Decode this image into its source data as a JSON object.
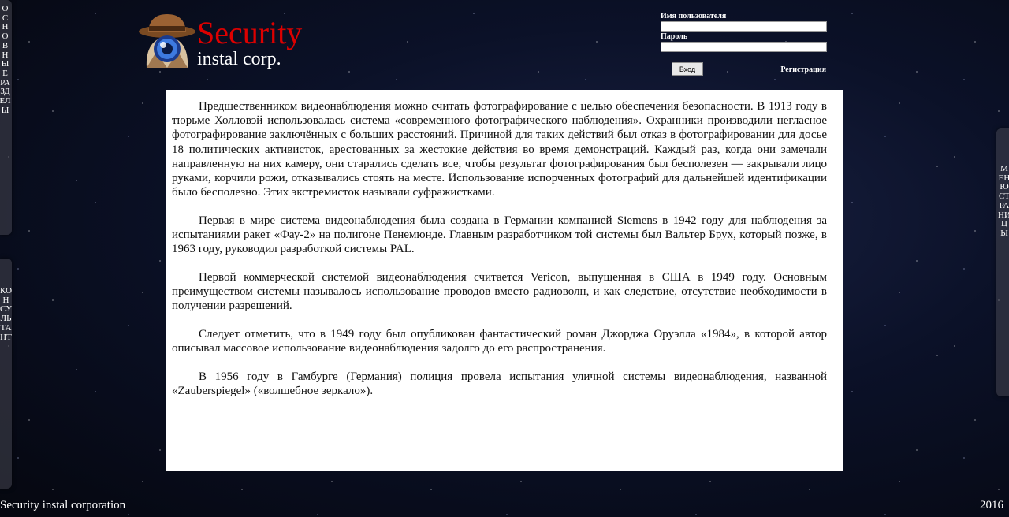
{
  "header": {
    "title": "Security",
    "subtitle": "instal corp.",
    "logo_icon": "spy-hat-eye-icon"
  },
  "login": {
    "username_label": "Имя пользователя",
    "username_value": "",
    "password_label": "Пароль",
    "password_value": "",
    "login_button": "Вход",
    "register_link": "Регистрация"
  },
  "side_tabs": {
    "left_top": "ОСНОВНЫЕ РАЗДЕЛЫ",
    "left_bottom": "КОНСУЛЬТАНТ",
    "right": "МЕНЮ СТРАНИЦЫ"
  },
  "content": {
    "paragraphs": [
      "Предшественником видеонаблюдения можно считать фотографирование с целью обеспечения безопасности. В 1913 году в тюрьме Холловэй использовалась система «современного фотографического наблюдения». Охранники производили негласное фотографирование заключённых с больших расстояний. Причиной для таких действий был отказ в фотографировании для досье 18 политических активисток, арестованных за жестокие действия во время демонстраций. Каждый раз, когда они замечали направленную на них камеру, они старались сделать все, чтобы результат фотографирования был бесполезен — закрывали лицо руками, корчили рожи, отказывались стоять на месте. Использование испорченных фотографий для дальнейшей идентификации было бесполезно. Этих экстремисток называли суфражистками.",
      "Первая в мире система видеонаблюдения была создана в Германии компанией Siemens в 1942 году для наблюдения за испытаниями ракет «Фау-2» на полигоне Пенемюнде. Главным разработчиком той системы был Вальтер Брух, который позже, в 1963 году, руководил разработкой системы PAL.",
      "Первой коммерческой системой видеонаблюдения считается Vericon, выпущенная в США в 1949 году. Основным преимуществом системы называлось использование проводов вместо радиоволн, и как следствие, отсутствие необходимости в получении разрешений.",
      "Следует отметить, что в 1949 году был опубликован фантастический роман Джорджа Оруэлла «1984», в которой автор описывал массовое использование видеонаблюдения задолго до его распространения.",
      "В 1956 году в Гамбурге (Германия) полиция провела испытания уличной системы видеонаблюдения, названной «Zauberspiegel» («волшебное зеркало»)."
    ]
  },
  "footer": {
    "left": "Security instal corporation",
    "right": "2016"
  },
  "colors": {
    "title_red": "#dd0000",
    "background_night": "#060a18",
    "content_bg": "#ffffff"
  }
}
